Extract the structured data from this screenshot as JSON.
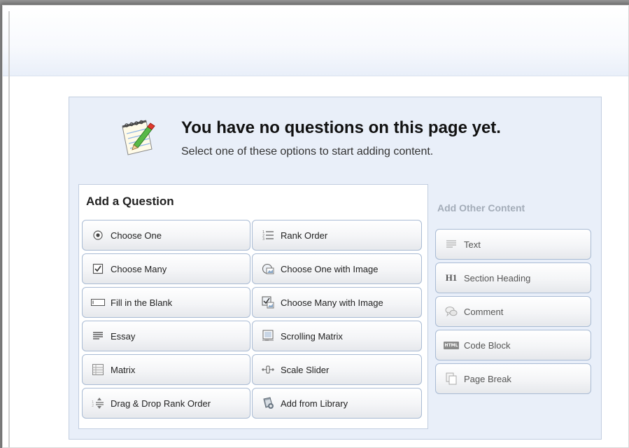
{
  "empty_state": {
    "title": "You have no questions on this page yet.",
    "subtitle": "Select one of these options to start adding content."
  },
  "add_question": {
    "title": "Add a Question",
    "buttons": [
      {
        "label": "Choose One",
        "icon": "radio-icon"
      },
      {
        "label": "Rank Order",
        "icon": "rank-order-icon"
      },
      {
        "label": "Choose Many",
        "icon": "checkbox-icon"
      },
      {
        "label": "Choose One with Image",
        "icon": "image-radio-icon"
      },
      {
        "label": "Fill in the Blank",
        "icon": "text-field-icon"
      },
      {
        "label": "Choose Many with Image",
        "icon": "image-checkbox-icon"
      },
      {
        "label": "Essay",
        "icon": "essay-lines-icon"
      },
      {
        "label": "Scrolling Matrix",
        "icon": "scrolling-matrix-icon"
      },
      {
        "label": "Matrix",
        "icon": "matrix-grid-icon"
      },
      {
        "label": "Scale Slider",
        "icon": "slider-icon"
      },
      {
        "label": "Drag & Drop Rank Order",
        "icon": "drag-drop-icon"
      },
      {
        "label": "Add from Library",
        "icon": "library-icon"
      }
    ]
  },
  "add_other": {
    "title": "Add Other Content",
    "buttons": [
      {
        "label": "Text",
        "icon": "text-icon"
      },
      {
        "label": "Section Heading",
        "icon": "heading-icon",
        "icon_text": "H1"
      },
      {
        "label": "Comment",
        "icon": "comment-icon"
      },
      {
        "label": "Code Block",
        "icon": "html-code-icon",
        "icon_text": "HTML"
      },
      {
        "label": "Page Break",
        "icon": "page-break-icon"
      }
    ]
  }
}
